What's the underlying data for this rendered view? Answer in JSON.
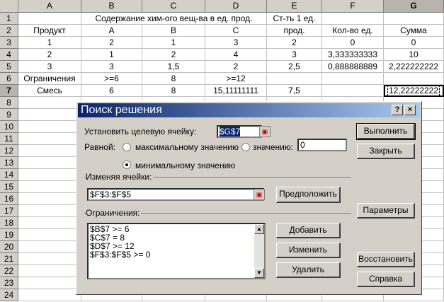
{
  "sheet": {
    "columns": [
      "A",
      "B",
      "C",
      "D",
      "E",
      "F",
      "G"
    ],
    "rows": [
      "1",
      "2",
      "3",
      "4",
      "5",
      "6",
      "7",
      "8",
      "9",
      "10",
      "11",
      "12",
      "13",
      "14",
      "15",
      "16",
      "17",
      "18",
      "19",
      "20",
      "21",
      "22",
      "23",
      "24"
    ],
    "cells": {
      "B1": "Содержание хим-ого вещ-ва в ед. прод.",
      "E1": "Ст-ть 1 ед.",
      "A2": "Продукт",
      "B2": "A",
      "C2": "B",
      "D2": "C",
      "E2": "прод.",
      "F2": "Кол-во ед.",
      "G2": "Сумма",
      "A3": "1",
      "B3": "2",
      "C3": "1",
      "D3": "3",
      "E3": "2",
      "F3": "0",
      "G3": "0",
      "A4": "2",
      "B4": "1",
      "C4": "2",
      "D4": "4",
      "E4": "3",
      "F4": "3,333333333",
      "G4": "10",
      "A5": "3",
      "B5": "3",
      "C5": "1,5",
      "D5": "2",
      "E5": "2,5",
      "F5": "0,888888889",
      "G5": "2,222222222",
      "A6": "Ограничения",
      "B6": ">=6",
      "C6": "8",
      "D6": ">=12",
      "A7": "Смесь",
      "B7": "6",
      "C7": "8",
      "D7": "15,11111111",
      "E7": "7,5",
      "G7": "12,22222222"
    }
  },
  "dialog": {
    "title": "Поиск решения",
    "help_btn": "?",
    "close_btn": "×",
    "target_label": "Установить целевую ячейку:",
    "target_value": "$G$7",
    "equal_label": "Равной:",
    "radio_max": "максимальному значению",
    "radio_value": "значению:",
    "value_field": "0",
    "radio_min": "минимальному значению",
    "changing_label": "Изменяя ячейки:",
    "changing_value": "$F$3:$F$5",
    "guess_btn": "Предположить",
    "constraints_label": "Ограничения:",
    "constraints": [
      "$B$7 >= 6",
      "$C$7 = 8",
      "$D$7 >= 12",
      "$F$3:$F$5 >= 0"
    ],
    "add_btn": "Добавить",
    "change_btn": "Изменить",
    "delete_btn": "Удалить",
    "solve_btn": "Выполнить",
    "close_dialog_btn": "Закрыть",
    "options_btn": "Параметры",
    "reset_btn": "Восстановить",
    "help_dialog_btn": "Справка"
  }
}
